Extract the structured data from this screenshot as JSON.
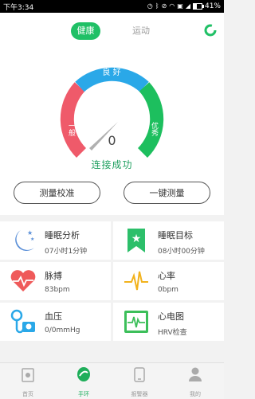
{
  "status_bar": {
    "time": "下午3:34",
    "battery": "41%",
    "battery_level": 0.41
  },
  "tabs": {
    "active": "健康",
    "inactive": "运动"
  },
  "gauge": {
    "segments": [
      "一般",
      "良 好",
      "优秀"
    ],
    "value": "0",
    "connection_status": "连接成功",
    "colors": {
      "general": "#ef5a6a",
      "good": "#2aa8e8",
      "excellent": "#1dbf5e"
    }
  },
  "buttons": {
    "calibrate": "测量校准",
    "one_key": "一键测量"
  },
  "cards": [
    {
      "title": "睡眠分析",
      "value": "07小时1分钟",
      "icon": "moon-stars-icon"
    },
    {
      "title": "睡眠目标",
      "value": "08小时00分钟",
      "icon": "star-ribbon-icon"
    },
    {
      "title": "脉搏",
      "value": "83bpm",
      "icon": "heart-pulse-icon"
    },
    {
      "title": "心率",
      "value": "0bpm",
      "icon": "heartbeat-wave-icon"
    },
    {
      "title": "血压",
      "value": "0/0mmHg",
      "icon": "blood-pressure-icon"
    },
    {
      "title": "心电图",
      "value": "HRV检查",
      "icon": "ecg-monitor-icon"
    }
  ],
  "bottom_nav": [
    {
      "label": "首页",
      "icon": "home-icon"
    },
    {
      "label": "手环",
      "icon": "bracelet-icon"
    },
    {
      "label": "报警器",
      "icon": "alarm-icon"
    },
    {
      "label": "我的",
      "icon": "user-icon"
    }
  ],
  "accent_color": "#20c066"
}
